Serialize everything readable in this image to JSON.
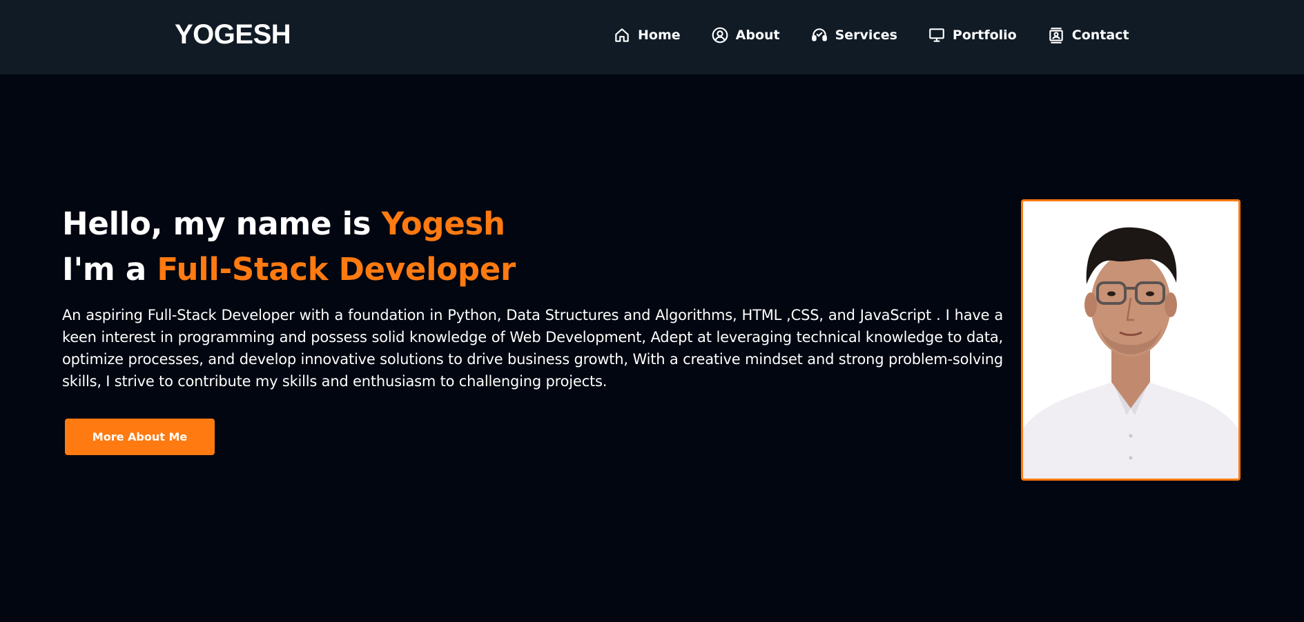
{
  "brand": {
    "name": "YOGESH"
  },
  "nav": {
    "items": [
      {
        "label": "Home",
        "icon": "home-icon"
      },
      {
        "label": "About",
        "icon": "user-circle-icon"
      },
      {
        "label": "Services",
        "icon": "headset-icon"
      },
      {
        "label": "Portfolio",
        "icon": "monitor-icon"
      },
      {
        "label": "Contact",
        "icon": "contact-card-icon"
      }
    ]
  },
  "hero": {
    "line1_prefix": "Hello, my name is ",
    "line1_highlight": "Yogesh",
    "line2_prefix": "I'm a ",
    "line2_highlight": "Full-Stack Developer",
    "intro": "An aspiring Full-Stack Developer with a foundation in Python, Data Structures and Algorithms, HTML ,CSS, and JavaScript . I have a keen interest in programming and possess solid knowledge of Web Development, Adept at leveraging technical knowledge to data, optimize processes, and develop innovative solutions to drive business growth, With a creative mindset and strong problem-solving skills, I strive to contribute my skills and enthusiasm to challenging projects.",
    "cta_label": "More About Me"
  },
  "colors": {
    "page_background": "#010610",
    "navbar_background": "#101b26",
    "accent": "#ff7a10",
    "text": "#ffffff"
  }
}
